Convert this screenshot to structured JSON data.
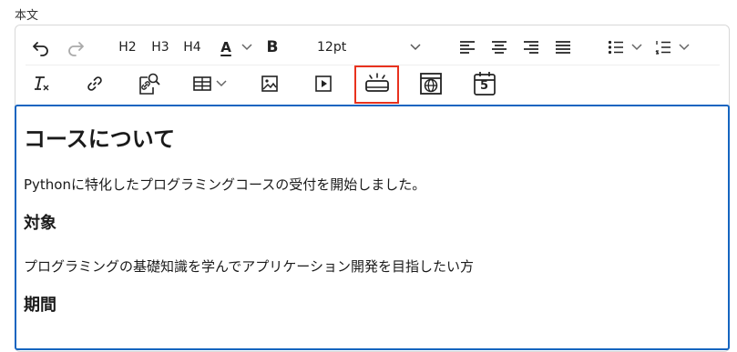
{
  "field": {
    "label": "本文"
  },
  "toolbar": {
    "heading_h2": "H2",
    "heading_h3": "H3",
    "heading_h4": "H4",
    "font_color_letter": "A",
    "bold_letter": "B",
    "font_size_value": "12pt",
    "calendar_day": "5",
    "accent_color": "#e8321e"
  },
  "content": {
    "title": "コースについて",
    "intro": "Pythonに特化したプログラミングコースの受付を開始しました。",
    "section1_heading": "対象",
    "section1_text": "プログラミングの基礎知識を学んでアプリケーション開発を目指したい方",
    "section2_heading": "期間"
  },
  "colors": {
    "focus_border": "#1565c0",
    "highlight": "#e8321e"
  }
}
